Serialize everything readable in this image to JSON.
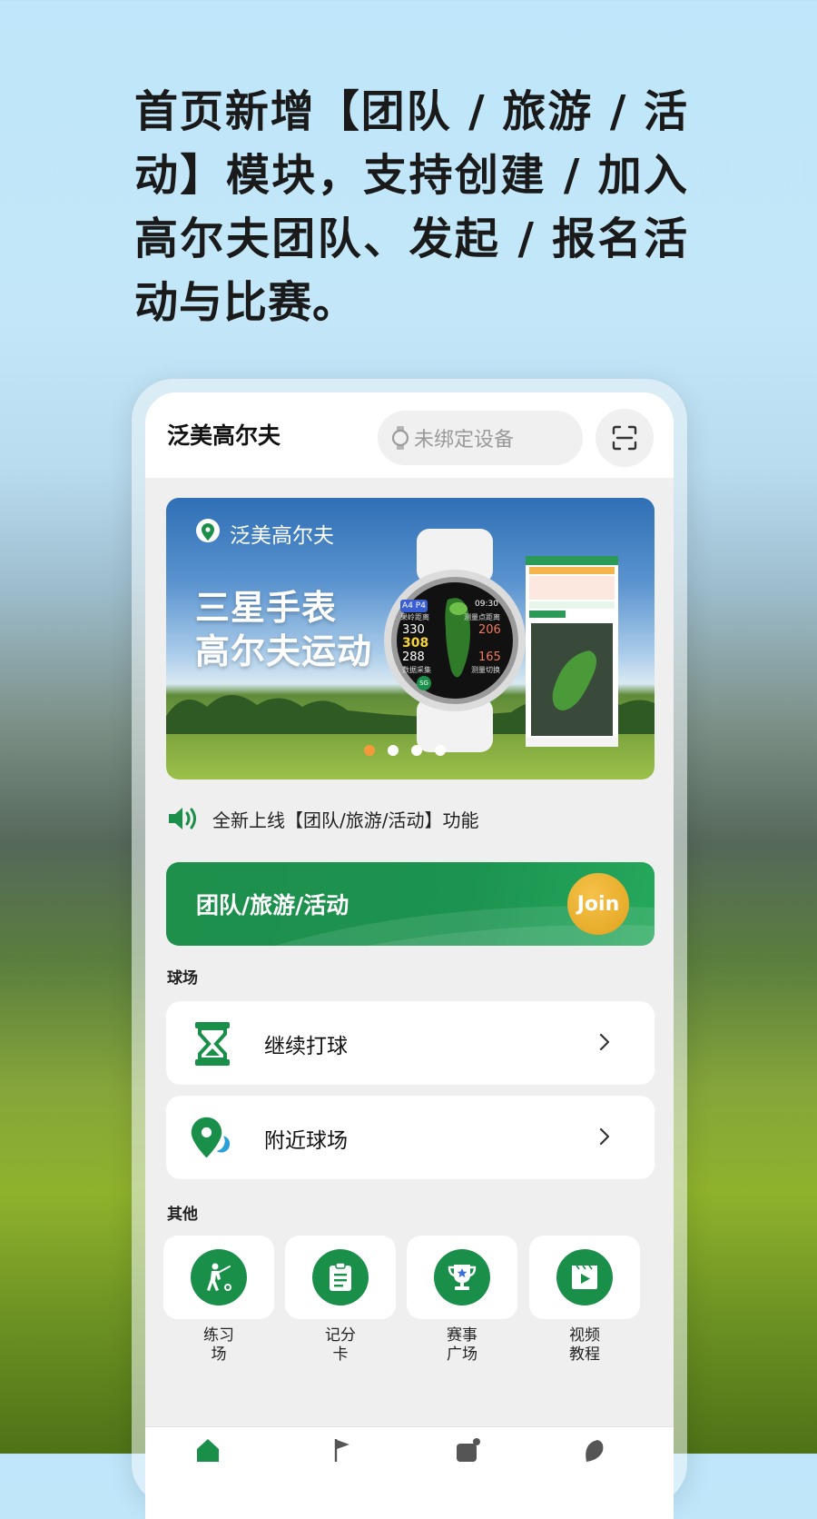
{
  "headline": "首页新增【团队 / 旅游 / 活动】模块，支持创建 / 加入高尔夫团队、发起 / 报名活动与比赛。",
  "app": {
    "title": "泛美高尔夫",
    "device_placeholder": "未绑定设备"
  },
  "banner": {
    "brand": "泛美高尔夫",
    "line1": "三星手表",
    "line2": "高尔夫运动",
    "watch": {
      "hole": "A4 P4",
      "time": "09:30",
      "left_caption": "果岭距离",
      "right_caption": "测量点距离",
      "front": "330",
      "middle": "308",
      "back": "288",
      "target_far": "206",
      "target_near": "165",
      "bottom_left": "数据采集",
      "bottom_right": "测量切换",
      "sg": "SG"
    },
    "slide_count": 4,
    "active_slide": 1
  },
  "notice": {
    "text": "全新上线【团队/旅游/活动】功能"
  },
  "team_card": {
    "label": "团队/旅游/活动",
    "join": "Join"
  },
  "sections": {
    "course": "球场",
    "other": "其他"
  },
  "course_rows": [
    {
      "label": "继续打球",
      "icon": "hourglass-icon"
    },
    {
      "label": "附近球场",
      "icon": "location-pin-icon"
    }
  ],
  "other_grid": [
    {
      "line1": "练习",
      "line2": "场",
      "icon": "golfer-icon"
    },
    {
      "line1": "记分",
      "line2": "卡",
      "icon": "scorecard-icon"
    },
    {
      "line1": "赛事",
      "line2": "广场",
      "icon": "trophy-icon"
    },
    {
      "line1": "视频",
      "line2": "教程",
      "icon": "video-icon"
    }
  ],
  "colors": {
    "brand_green": "#1a8f4a",
    "join_gold": "#e8ac25",
    "active_dot": "#f59a3a"
  }
}
